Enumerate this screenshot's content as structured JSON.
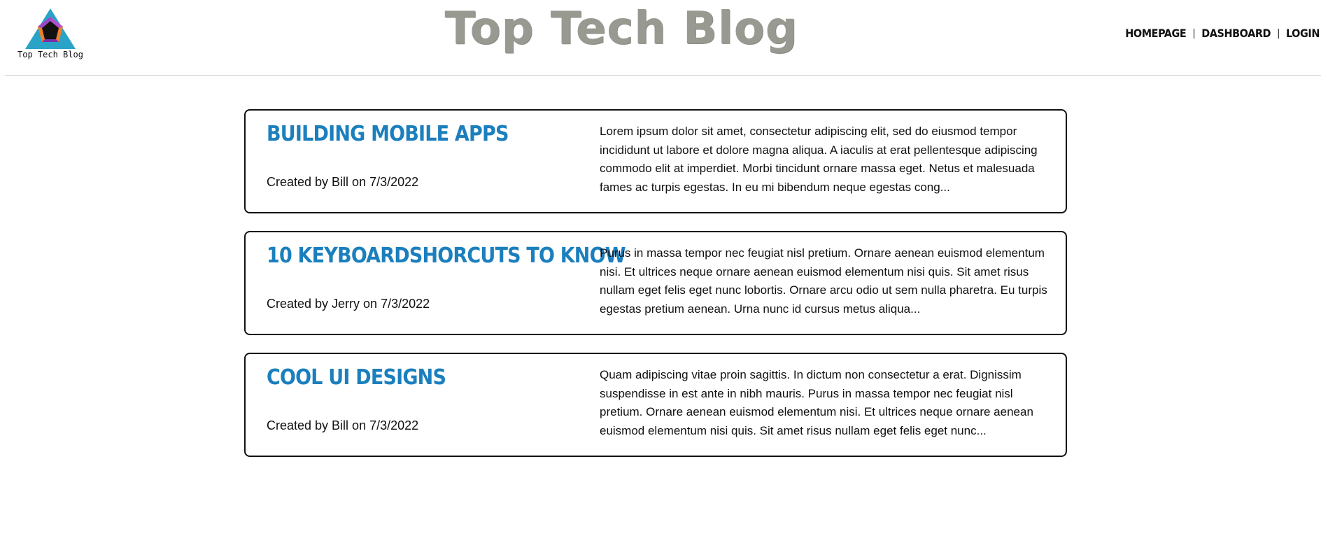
{
  "header": {
    "logo_caption": "Top Tech Blog",
    "site_title": "Top Tech Blog",
    "title_color": "#989a91"
  },
  "nav": {
    "items": [
      {
        "label": "HOMEPAGE"
      },
      {
        "label": "DASHBOARD"
      },
      {
        "label": "LOGIN"
      }
    ],
    "separator": "|"
  },
  "theme": {
    "post_title_color": "#1b7fbd"
  },
  "posts": [
    {
      "title": "Building mobile apps",
      "meta": "Created by Bill on 7/3/2022",
      "excerpt": "Lorem ipsum dolor sit amet, consectetur adipiscing elit, sed do eiusmod tempor incididunt ut labore et dolore magna aliqua. A iaculis at erat pellentesque adipiscing commodo elit at imperdiet. Morbi tincidunt ornare massa eget. Netus et malesuada fames ac turpis egestas. In eu mi bibendum neque egestas cong..."
    },
    {
      "title": "10 keyboardshorcuts to know",
      "meta": "Created by Jerry on 7/3/2022",
      "excerpt": "Purus in massa tempor nec feugiat nisl pretium. Ornare aenean euismod elementum nisi. Et ultrices neque ornare aenean euismod elementum nisi quis. Sit amet risus nullam eget felis eget nunc lobortis. Ornare arcu odio ut sem nulla pharetra. Eu turpis egestas pretium aenean. Urna nunc id cursus metus aliqua..."
    },
    {
      "title": "Cool UI designs",
      "meta": "Created by Bill on 7/3/2022",
      "excerpt": "Quam adipiscing vitae proin sagittis. In dictum non consectetur a erat. Dignissim suspendisse in est ante in nibh mauris. Purus in massa tempor nec feugiat nisl pretium. Ornare aenean euismod elementum nisi. Et ultrices neque ornare aenean euismod elementum nisi quis. Sit amet risus nullam eget felis eget nunc..."
    }
  ]
}
